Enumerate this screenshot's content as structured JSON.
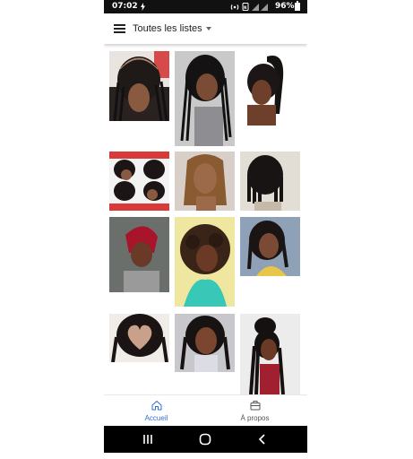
{
  "status_bar": {
    "time": "07:02",
    "battery_percent": "96%",
    "battery_level": 0.96,
    "icons": [
      "flash-icon",
      "hotspot-icon",
      "nfc-icon",
      "signal-icon",
      "battery-icon"
    ]
  },
  "app_bar": {
    "menu_icon": "menu-icon",
    "list_title": "Toutes les listes",
    "dropdown_icon": "caret-down-icon"
  },
  "gallery": {
    "items": [
      {
        "name": "hairstyle-photo-1",
        "subject": "cornrow braids top view"
      },
      {
        "name": "hairstyle-photo-2",
        "subject": "long straight-back braids"
      },
      {
        "name": "hairstyle-photo-3",
        "subject": "high braided ponytail"
      },
      {
        "name": "hairstyle-photo-4",
        "subject": "braided bob collage"
      },
      {
        "name": "hairstyle-photo-5",
        "subject": "straight bob with highlights"
      },
      {
        "name": "hairstyle-photo-6",
        "subject": "box braids bob"
      },
      {
        "name": "hairstyle-photo-7",
        "subject": "short red pixie cut"
      },
      {
        "name": "hairstyle-photo-8",
        "subject": "curly afro bob"
      },
      {
        "name": "hairstyle-photo-9",
        "subject": "shoulder-length braids"
      },
      {
        "name": "hairstyle-photo-10",
        "subject": "heart pattern braids"
      },
      {
        "name": "hairstyle-photo-11",
        "subject": "long braids selfie"
      },
      {
        "name": "hairstyle-photo-12",
        "subject": "braided updo long"
      }
    ]
  },
  "bottom_nav": {
    "items": [
      {
        "label": "Accueil",
        "icon": "home-icon",
        "active": true
      },
      {
        "label": "À propos",
        "icon": "briefcase-icon",
        "active": false
      }
    ],
    "active_color": "#2f6fd8",
    "inactive_color": "#555555"
  },
  "system_nav": {
    "buttons": [
      "recents-icon",
      "home-circle-icon",
      "back-icon"
    ]
  },
  "colors": {
    "status_bar_bg": "#111111",
    "system_nav_bg": "#000000",
    "accent": "#2f6fd8"
  }
}
